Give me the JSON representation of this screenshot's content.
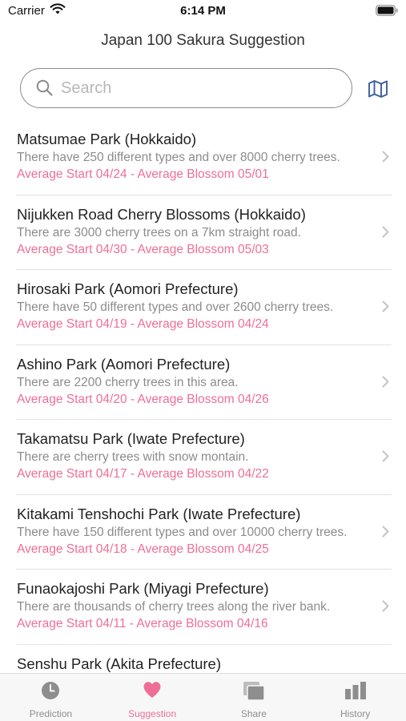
{
  "status_bar": {
    "carrier": "Carrier",
    "time": "6:14 PM"
  },
  "header": {
    "title": "Japan 100 Sakura Suggestion"
  },
  "search": {
    "placeholder": "Search",
    "value": ""
  },
  "list": {
    "items": [
      {
        "title": "Matsumae Park (Hokkaido)",
        "description": "There have 250 different types and over 8000 cherry trees.",
        "dates": "Average Start 04/24 - Average Blossom 05/01"
      },
      {
        "title": "Nijukken Road Cherry Blossoms (Hokkaido)",
        "description": "There are 3000 cherry trees on a 7km straight road.",
        "dates": "Average Start 04/30 - Average Blossom 05/03"
      },
      {
        "title": "Hirosaki Park (Aomori Prefecture)",
        "description": "There have 50 different types and over 2600 cherry trees.",
        "dates": "Average Start 04/19 - Average Blossom 04/24"
      },
      {
        "title": "Ashino Park (Aomori Prefecture)",
        "description": "There are 2200 cherry trees in this area.",
        "dates": "Average Start 04/20 - Average Blossom 04/26"
      },
      {
        "title": "Takamatsu Park (Iwate Prefecture)",
        "description": "There are cherry trees with snow montain.",
        "dates": "Average Start 04/17 - Average Blossom 04/22"
      },
      {
        "title": "Kitakami Tenshochi Park (Iwate Prefecture)",
        "description": "There have 150 different types and over 10000 cherry trees.",
        "dates": "Average Start 04/18 - Average Blossom 04/25"
      },
      {
        "title": "Funaokajoshi Park (Miyagi Prefecture)",
        "description": "There are thousands of cherry trees along the river bank.",
        "dates": "Average Start 04/11 - Average Blossom 04/16"
      },
      {
        "title": "Senshu Park (Akita Prefecture)",
        "description": "",
        "dates": ""
      }
    ]
  },
  "tab_bar": {
    "tabs": [
      {
        "label": "Prediction",
        "icon": "clock-icon"
      },
      {
        "label": "Suggestion",
        "icon": "heart-icon"
      },
      {
        "label": "Share",
        "icon": "share-icon"
      },
      {
        "label": "History",
        "icon": "bar-chart-icon"
      }
    ],
    "active": "Suggestion"
  },
  "colors": {
    "accent_pink": "#ee6f96",
    "map_icon_blue": "#3a5f9e",
    "inactive_gray": "#8e8e8e"
  }
}
